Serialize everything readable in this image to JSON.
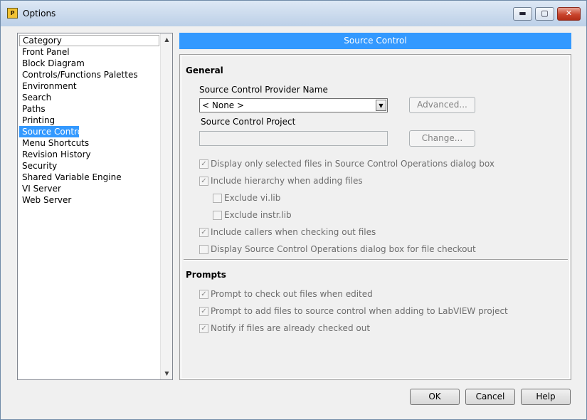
{
  "window": {
    "title": "Options",
    "app_icon_text": "P",
    "controls": {
      "minimize": "▬",
      "maximize": "▢",
      "close": "✕"
    }
  },
  "sidebar": {
    "header": "Category",
    "items": [
      "Front Panel",
      "Block Diagram",
      "Controls/Functions Palettes",
      "Environment",
      "Search",
      "Paths",
      "Printing",
      "Source Control",
      "Menu Shortcuts",
      "Revision History",
      "Security",
      "Shared Variable Engine",
      "VI Server",
      "Web Server"
    ],
    "selected": "Source Control"
  },
  "pane": {
    "header": "Source Control",
    "general": {
      "title": "General",
      "provider_label": "Source Control Provider Name",
      "provider_value": "< None >",
      "advanced_button": "Advanced...",
      "project_label": "Source Control Project",
      "change_button": "Change...",
      "options": [
        {
          "label": "Display only selected files in Source Control Operations dialog box",
          "checked": true
        },
        {
          "label": "Include hierarchy when adding files",
          "checked": true
        },
        {
          "label": "Exclude vi.lib",
          "checked": false
        },
        {
          "label": "Exclude instr.lib",
          "checked": false
        },
        {
          "label": "Include callers when checking out files",
          "checked": true
        },
        {
          "label": "Display Source Control Operations dialog box for file checkout",
          "checked": false
        }
      ]
    },
    "prompts": {
      "title": "Prompts",
      "options": [
        {
          "label": "Prompt to check out files when edited",
          "checked": true
        },
        {
          "label": "Prompt to add files to source control when adding to LabVIEW project",
          "checked": true
        },
        {
          "label": "Notify if files are already checked out",
          "checked": true
        }
      ]
    }
  },
  "footer": {
    "ok": "OK",
    "cancel": "Cancel",
    "help": "Help"
  }
}
